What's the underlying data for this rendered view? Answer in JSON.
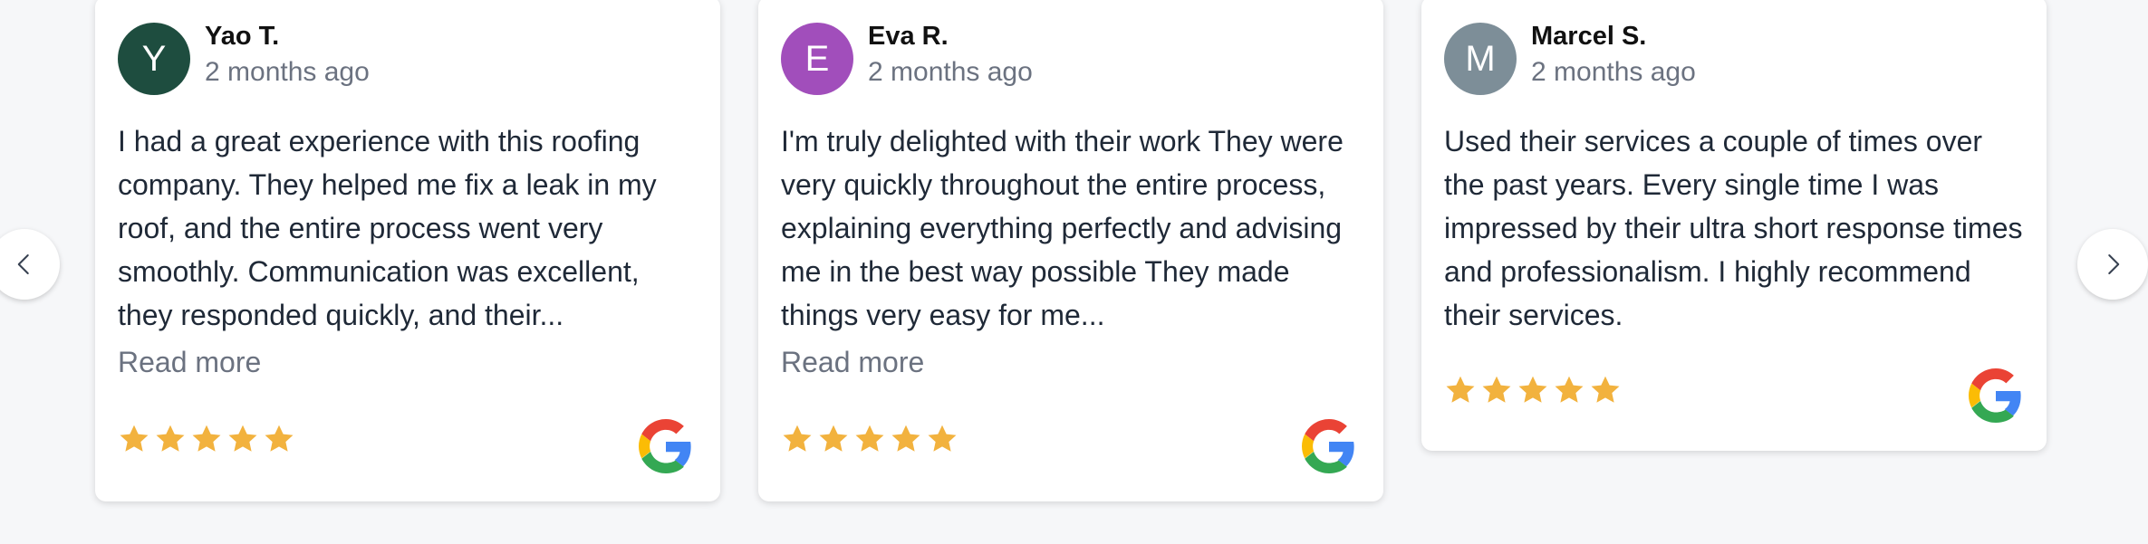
{
  "navigation": {
    "prev_icon": "chevron-left-icon",
    "next_icon": "chevron-right-icon"
  },
  "colors": {
    "star": "#F2B23E",
    "google_blue": "#4285F4",
    "google_red": "#EA4335",
    "google_yellow": "#FBBC05",
    "google_green": "#34A853"
  },
  "reviews": [
    {
      "initial": "Y",
      "avatar_color": "#1E4D3F",
      "name": "Yao T.",
      "time": "2 months ago",
      "text": "I had a great experience with this roofing company. They helped me fix a leak in my roof, and the entire process went very smoothly. Communication was excellent, they responded quickly, and their...",
      "read_more": "Read more",
      "rating": 5,
      "source_icon": "google-logo-icon"
    },
    {
      "initial": "E",
      "avatar_color": "#A14EBB",
      "name": "Eva R.",
      "time": "2 months ago",
      "text": "I'm truly delighted with their work They were very quickly throughout the entire process, explaining everything perfectly and advising me in the best way possible They made things very easy for me...",
      "read_more": "Read more",
      "rating": 5,
      "source_icon": "google-logo-icon"
    },
    {
      "initial": "M",
      "avatar_color": "#7D8E98",
      "name": "Marcel S.",
      "time": "2 months ago",
      "text": "Used their services a couple of times over the past years. Every single time I was impressed by their ultra short response times and professionalism. I highly recommend their services.",
      "rating": 5,
      "source_icon": "google-logo-icon"
    }
  ]
}
